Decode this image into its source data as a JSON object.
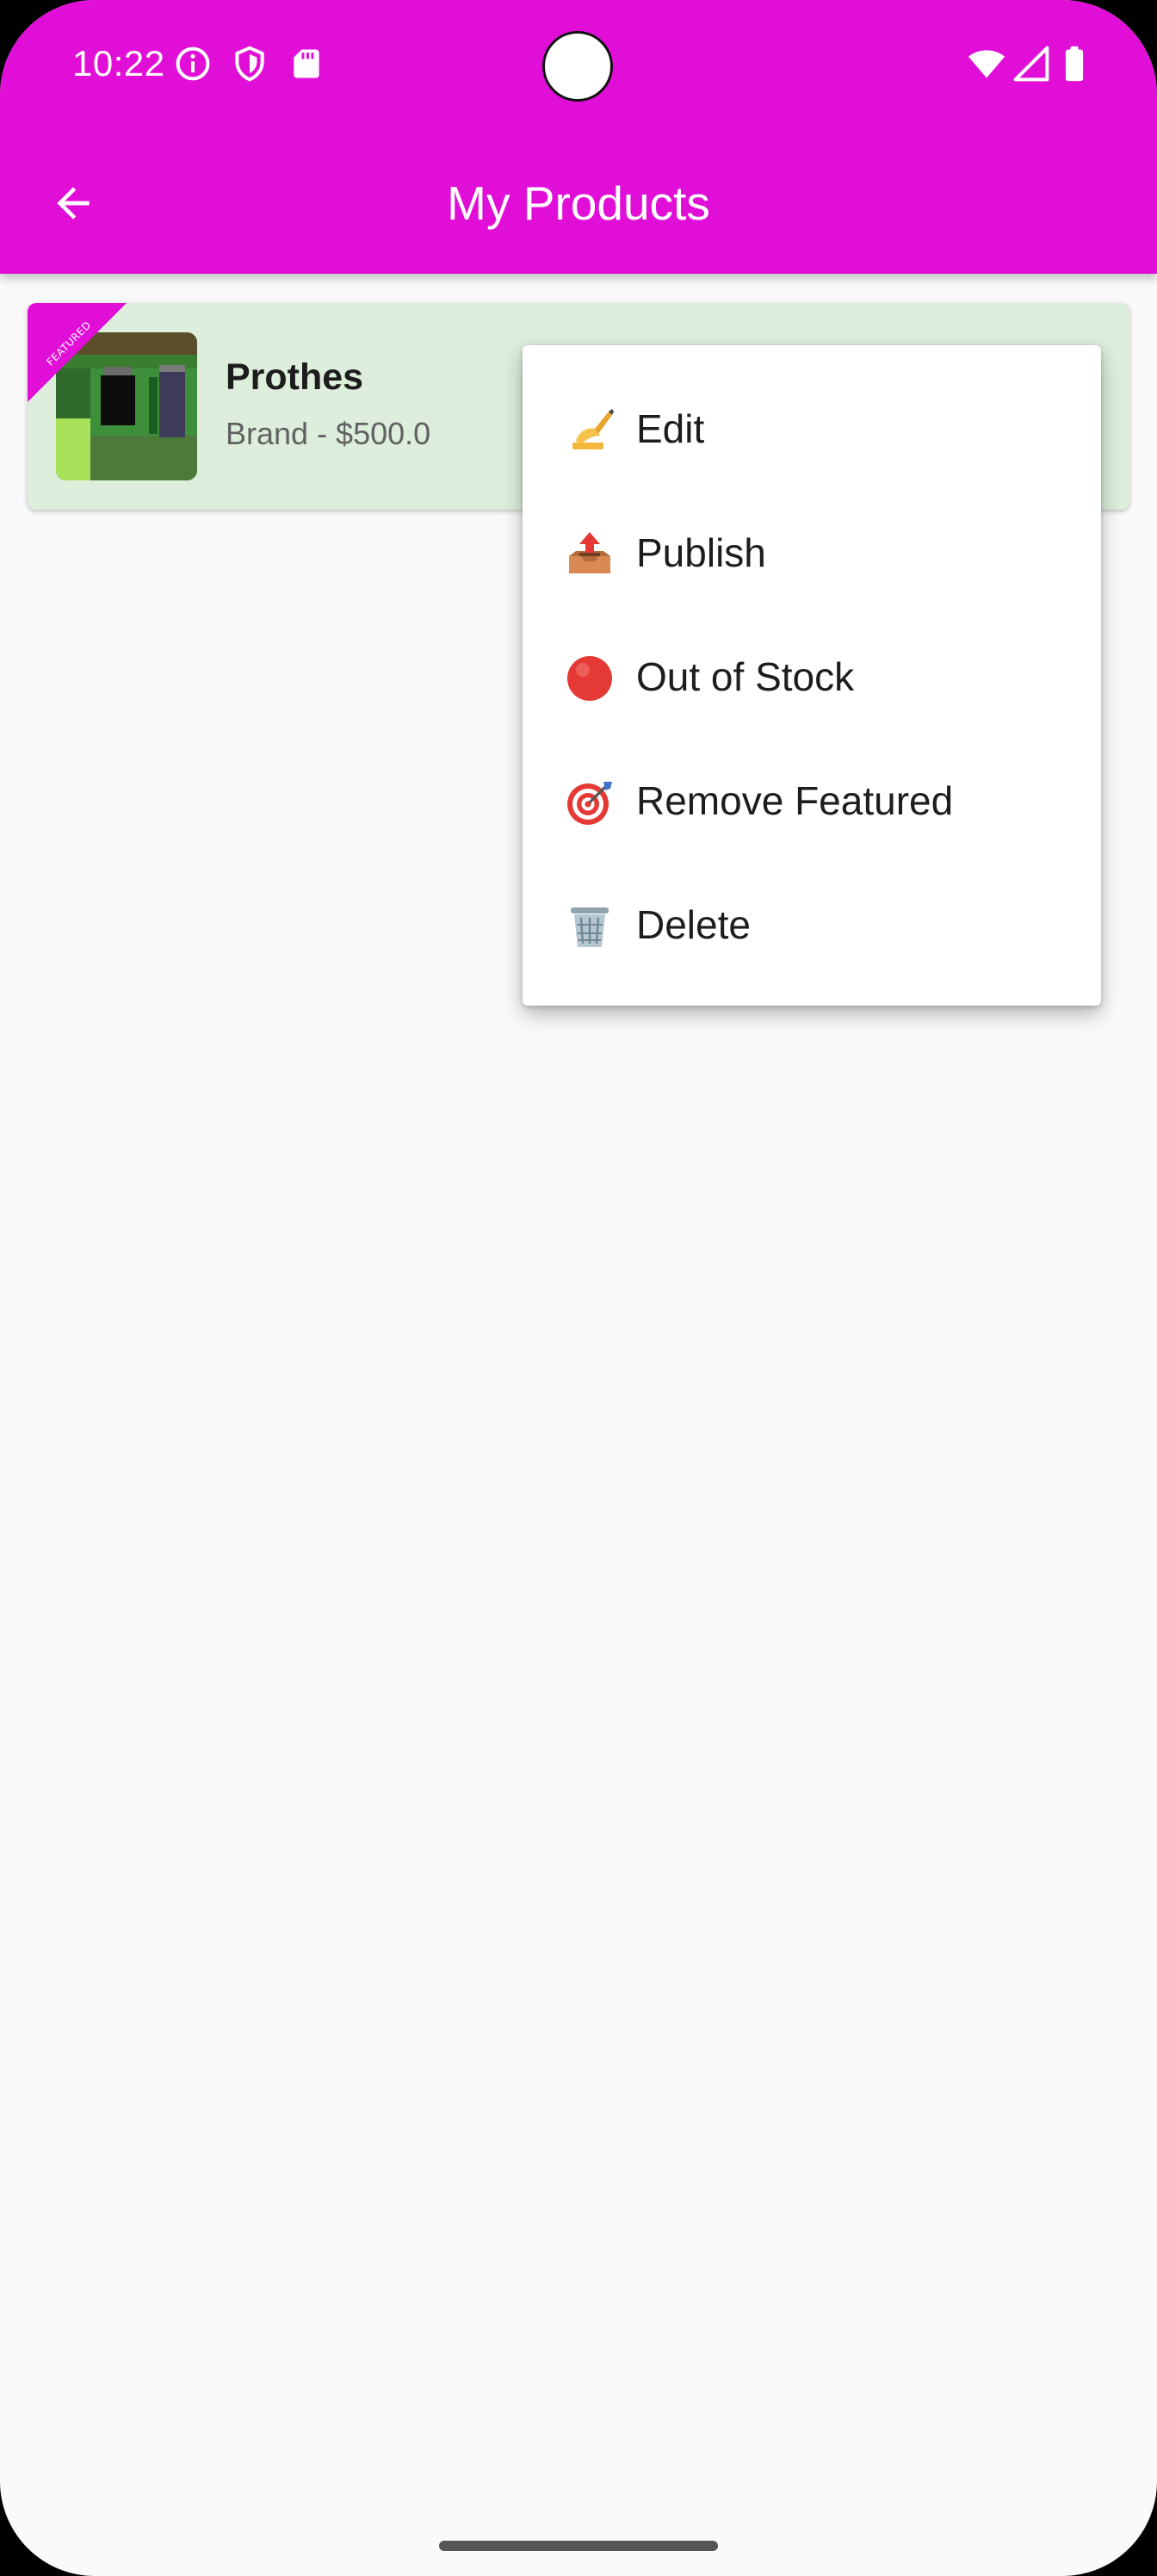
{
  "status_bar": {
    "time": "10:22",
    "left_icons": [
      "info-icon",
      "shield-icon",
      "sd-card-icon"
    ],
    "right_icons": [
      "wifi-icon",
      "signal-icon",
      "battery-icon"
    ]
  },
  "app_bar": {
    "title": "My Products",
    "back_icon": "arrow-back-icon",
    "color": "#e10ed7"
  },
  "products": [
    {
      "name": "Prothes",
      "meta": "Brand - $500.0",
      "badge": "FEATURED",
      "badge_color": "#e10ed7",
      "card_color": "#ddeedd"
    }
  ],
  "menu": {
    "items": [
      {
        "emoji": "✍️",
        "label": "Edit",
        "icon": "writing-hand-icon"
      },
      {
        "emoji": "📤",
        "label": "Publish",
        "icon": "outbox-tray-icon"
      },
      {
        "emoji": "🔴",
        "label": "Out of Stock",
        "icon": "red-circle-icon"
      },
      {
        "emoji": "🎯",
        "label": "Remove Featured",
        "icon": "target-icon"
      },
      {
        "emoji": "🗑️",
        "label": "Delete",
        "icon": "wastebasket-icon"
      }
    ]
  }
}
